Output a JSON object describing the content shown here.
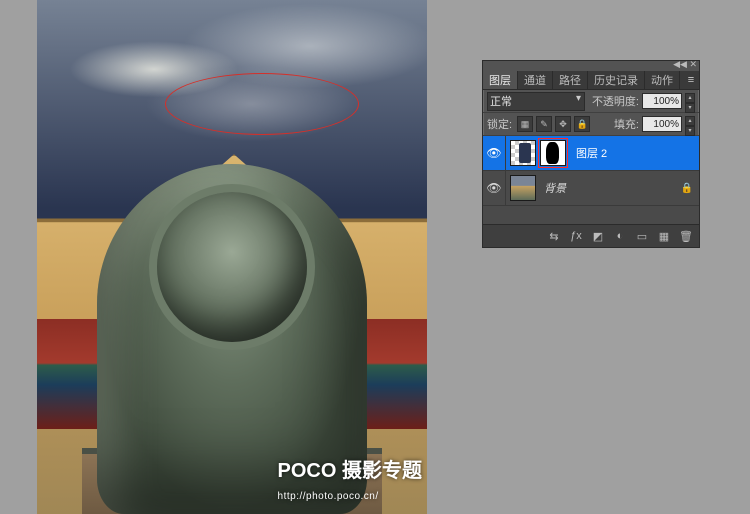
{
  "watermark": {
    "brand": "POCO",
    "title": "摄影专题",
    "url": "http://photo.poco.cn/"
  },
  "panel": {
    "tabs": [
      "图层",
      "通道",
      "路径",
      "历史记录",
      "动作"
    ],
    "active_tab": 0,
    "blend_mode_label": "正常",
    "opacity_label": "不透明度:",
    "opacity_value": "100%",
    "lock_label": "锁定:",
    "fill_label": "填充:",
    "fill_value": "100%",
    "layers": [
      {
        "name": "图层 2",
        "visible": true,
        "has_mask": true,
        "selected": true,
        "locked": false
      },
      {
        "name": "背景",
        "visible": true,
        "has_mask": false,
        "selected": false,
        "locked": true
      }
    ],
    "footer_icons": [
      "link-icon",
      "fx-icon",
      "mask-icon",
      "adjust-icon",
      "group-icon",
      "new-icon",
      "trash-icon"
    ]
  }
}
